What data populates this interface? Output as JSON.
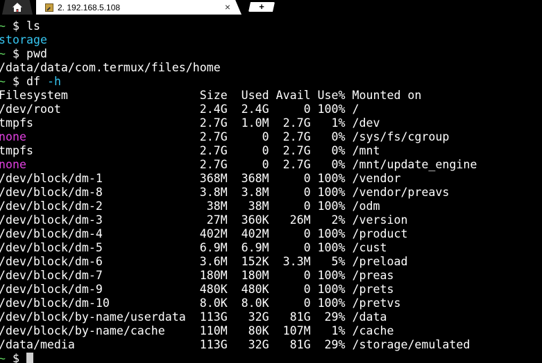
{
  "tabs": {
    "home_icon": "home-icon",
    "active_title": "2. 192.168.5.108",
    "close_glyph": "×",
    "new_tab_glyph": "+"
  },
  "terminal": {
    "prompt_tilde": "~",
    "prompt_dollar": "$",
    "commands": {
      "ls": "ls",
      "pwd": "pwd",
      "df": "df",
      "df_flag": "-h"
    },
    "ls_output": "storage",
    "pwd_output": "/data/data/com.termux/files/home",
    "df_header": "Filesystem                   Size  Used Avail Use% Mounted on",
    "df_rows": [
      {
        "fs": "/dev/root",
        "rest": "                    2.4G  2.4G     0 100% /",
        "color": "white"
      },
      {
        "fs": "tmpfs",
        "rest": "                        2.7G  1.0M  2.7G   1% /dev",
        "color": "white"
      },
      {
        "fs": "none",
        "rest": "                         2.7G     0  2.7G   0% /sys/fs/cgroup",
        "color": "magenta"
      },
      {
        "fs": "tmpfs",
        "rest": "                        2.7G     0  2.7G   0% /mnt",
        "color": "white"
      },
      {
        "fs": "none",
        "rest": "                         2.7G     0  2.7G   0% /mnt/update_engine",
        "color": "magenta"
      },
      {
        "fs": "/dev/block/dm-1",
        "rest": "              368M  368M     0 100% /vendor",
        "color": "white"
      },
      {
        "fs": "/dev/block/dm-8",
        "rest": "              3.8M  3.8M     0 100% /vendor/preavs",
        "color": "white"
      },
      {
        "fs": "/dev/block/dm-2",
        "rest": "               38M   38M     0 100% /odm",
        "color": "white"
      },
      {
        "fs": "/dev/block/dm-3",
        "rest": "               27M  360K   26M   2% /version",
        "color": "white"
      },
      {
        "fs": "/dev/block/dm-4",
        "rest": "              402M  402M     0 100% /product",
        "color": "white"
      },
      {
        "fs": "/dev/block/dm-5",
        "rest": "              6.9M  6.9M     0 100% /cust",
        "color": "white"
      },
      {
        "fs": "/dev/block/dm-6",
        "rest": "              3.6M  152K  3.3M   5% /preload",
        "color": "white"
      },
      {
        "fs": "/dev/block/dm-7",
        "rest": "              180M  180M     0 100% /preas",
        "color": "white"
      },
      {
        "fs": "/dev/block/dm-9",
        "rest": "              480K  480K     0 100% /prets",
        "color": "white"
      },
      {
        "fs": "/dev/block/dm-10",
        "rest": "             8.0K  8.0K     0 100% /pretvs",
        "color": "white"
      },
      {
        "fs": "/dev/block/by-name/userdata",
        "rest": "  113G   32G   81G  29% /data",
        "color": "white"
      },
      {
        "fs": "/dev/block/by-name/cache",
        "rest": "     110M   80K  107M   1% /cache",
        "color": "white"
      },
      {
        "fs": "/data/media",
        "rest": "                  113G   32G   81G  29% /storage/emulated",
        "color": "white"
      }
    ]
  },
  "colors": {
    "background": "#000000",
    "prompt_green": "#5fd35f",
    "cyan": "#36c5f0",
    "magenta": "#e040e0",
    "text": "#ffffff"
  }
}
